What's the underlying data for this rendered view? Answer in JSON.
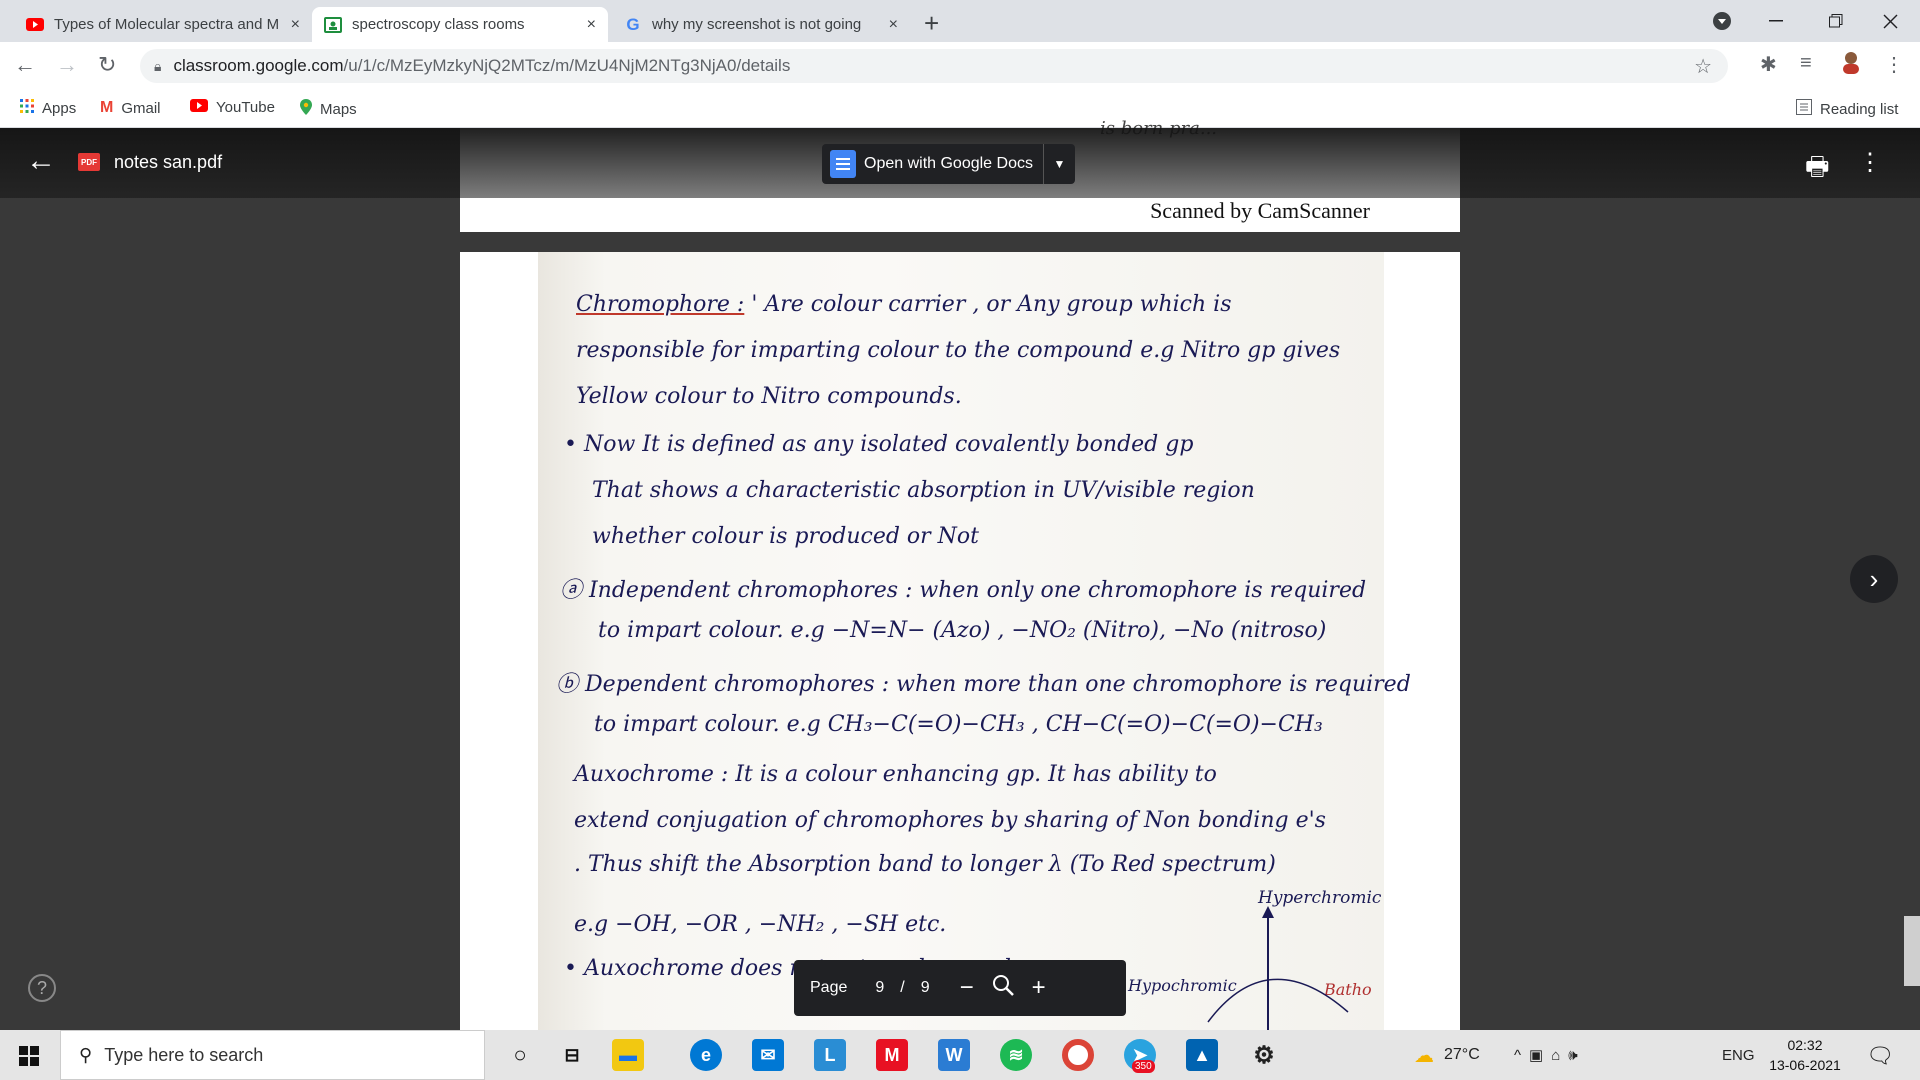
{
  "browser": {
    "tabs": [
      {
        "title": "Types of Molecular spectra and M",
        "icon": "youtube-icon"
      },
      {
        "title": "spectroscopy class rooms",
        "icon": "classroom-icon"
      },
      {
        "title": "why my screenshot is not going",
        "icon": "google-icon"
      }
    ],
    "new_tab_glyph": "+",
    "close_glyph": "×",
    "url_host": "classroom.google.com",
    "url_path": "/u/1/c/MzEyMzkyNjQ2MTcz/m/MzU4NjM2NTg3NjA0/details",
    "bookmarks": [
      {
        "label": "Apps",
        "icon": "apps-grid-icon"
      },
      {
        "label": "Gmail",
        "icon": "gmail-icon"
      },
      {
        "label": "YouTube",
        "icon": "youtube-icon"
      },
      {
        "label": "Maps",
        "icon": "maps-pin-icon"
      }
    ],
    "reading_list": "Reading list"
  },
  "viewer": {
    "file_badge": "PDF",
    "file_name": "notes san.pdf",
    "open_with_label": "Open with Google Docs",
    "prev_page_footer": "Scanned by CamScanner",
    "prev_page_scribble": "is born pra...",
    "page_label": "Page",
    "page_current": "9",
    "page_separator": "/",
    "page_total": "9",
    "zoom_out": "−",
    "zoom_in": "+",
    "next_glyph": "›",
    "help_glyph": "?"
  },
  "notes": {
    "l1a": "Chromophore :",
    "l1b": "' Are colour carrier , or Any group which is",
    "l2": "responsible for imparting colour to the compound e.g Nitro gp gives",
    "l3": "Yellow colour to Nitro compounds.",
    "l4": "• Now It is defined as any isolated covalently bonded gp",
    "l5": "That shows a characteristic absorption in UV/visible region",
    "l6": "whether colour is produced or Not",
    "l7": "ⓐ Independent chromophores : when only one chromophore is required",
    "l8": "to impart colour. e.g   −N=N− (Azo) ,  −NO₂ (Nitro), −No (nitroso)",
    "l9": "ⓑ Dependent chromophores : when more than one chromophore is required",
    "l10": "to impart colour. e.g   CH₃−C(=O)−CH₃  ,   CH−C(=O)−C(=O)−CH₃",
    "l11": "Auxochrome : It is a colour enhancing gp. It has ability to",
    "l12": "extend conjugation of chromophores by sharing of Non bonding e's",
    "l13": ". Thus shift the Absorption band to longer λ (To Red spectrum)",
    "l14": "Hyperchromic",
    "l15": "e.g  −OH, −OR , −NH₂ , −SH etc.",
    "l16": "• Auxochrome does not act as chromophore",
    "l17": "Hypochromic",
    "l18": "Batho"
  },
  "taskbar": {
    "search_placeholder": "Type here to search",
    "temperature": "27°C",
    "language": "ENG",
    "time": "02:32",
    "date": "13-06-2021",
    "badge_count": "350"
  }
}
